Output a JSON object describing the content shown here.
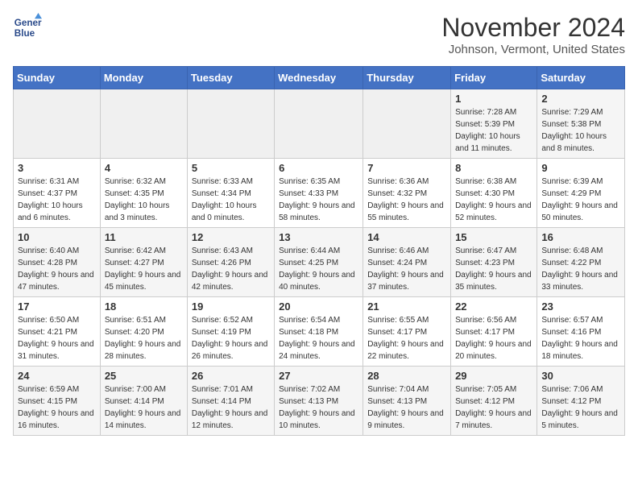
{
  "logo": {
    "line1": "General",
    "line2": "Blue"
  },
  "title": "November 2024",
  "location": "Johnson, Vermont, United States",
  "days_of_week": [
    "Sunday",
    "Monday",
    "Tuesday",
    "Wednesday",
    "Thursday",
    "Friday",
    "Saturday"
  ],
  "weeks": [
    [
      {
        "day": "",
        "sunrise": "",
        "sunset": "",
        "daylight": ""
      },
      {
        "day": "",
        "sunrise": "",
        "sunset": "",
        "daylight": ""
      },
      {
        "day": "",
        "sunrise": "",
        "sunset": "",
        "daylight": ""
      },
      {
        "day": "",
        "sunrise": "",
        "sunset": "",
        "daylight": ""
      },
      {
        "day": "",
        "sunrise": "",
        "sunset": "",
        "daylight": ""
      },
      {
        "day": "1",
        "sunrise": "Sunrise: 7:28 AM",
        "sunset": "Sunset: 5:39 PM",
        "daylight": "Daylight: 10 hours and 11 minutes."
      },
      {
        "day": "2",
        "sunrise": "Sunrise: 7:29 AM",
        "sunset": "Sunset: 5:38 PM",
        "daylight": "Daylight: 10 hours and 8 minutes."
      }
    ],
    [
      {
        "day": "3",
        "sunrise": "Sunrise: 6:31 AM",
        "sunset": "Sunset: 4:37 PM",
        "daylight": "Daylight: 10 hours and 6 minutes."
      },
      {
        "day": "4",
        "sunrise": "Sunrise: 6:32 AM",
        "sunset": "Sunset: 4:35 PM",
        "daylight": "Daylight: 10 hours and 3 minutes."
      },
      {
        "day": "5",
        "sunrise": "Sunrise: 6:33 AM",
        "sunset": "Sunset: 4:34 PM",
        "daylight": "Daylight: 10 hours and 0 minutes."
      },
      {
        "day": "6",
        "sunrise": "Sunrise: 6:35 AM",
        "sunset": "Sunset: 4:33 PM",
        "daylight": "Daylight: 9 hours and 58 minutes."
      },
      {
        "day": "7",
        "sunrise": "Sunrise: 6:36 AM",
        "sunset": "Sunset: 4:32 PM",
        "daylight": "Daylight: 9 hours and 55 minutes."
      },
      {
        "day": "8",
        "sunrise": "Sunrise: 6:38 AM",
        "sunset": "Sunset: 4:30 PM",
        "daylight": "Daylight: 9 hours and 52 minutes."
      },
      {
        "day": "9",
        "sunrise": "Sunrise: 6:39 AM",
        "sunset": "Sunset: 4:29 PM",
        "daylight": "Daylight: 9 hours and 50 minutes."
      }
    ],
    [
      {
        "day": "10",
        "sunrise": "Sunrise: 6:40 AM",
        "sunset": "Sunset: 4:28 PM",
        "daylight": "Daylight: 9 hours and 47 minutes."
      },
      {
        "day": "11",
        "sunrise": "Sunrise: 6:42 AM",
        "sunset": "Sunset: 4:27 PM",
        "daylight": "Daylight: 9 hours and 45 minutes."
      },
      {
        "day": "12",
        "sunrise": "Sunrise: 6:43 AM",
        "sunset": "Sunset: 4:26 PM",
        "daylight": "Daylight: 9 hours and 42 minutes."
      },
      {
        "day": "13",
        "sunrise": "Sunrise: 6:44 AM",
        "sunset": "Sunset: 4:25 PM",
        "daylight": "Daylight: 9 hours and 40 minutes."
      },
      {
        "day": "14",
        "sunrise": "Sunrise: 6:46 AM",
        "sunset": "Sunset: 4:24 PM",
        "daylight": "Daylight: 9 hours and 37 minutes."
      },
      {
        "day": "15",
        "sunrise": "Sunrise: 6:47 AM",
        "sunset": "Sunset: 4:23 PM",
        "daylight": "Daylight: 9 hours and 35 minutes."
      },
      {
        "day": "16",
        "sunrise": "Sunrise: 6:48 AM",
        "sunset": "Sunset: 4:22 PM",
        "daylight": "Daylight: 9 hours and 33 minutes."
      }
    ],
    [
      {
        "day": "17",
        "sunrise": "Sunrise: 6:50 AM",
        "sunset": "Sunset: 4:21 PM",
        "daylight": "Daylight: 9 hours and 31 minutes."
      },
      {
        "day": "18",
        "sunrise": "Sunrise: 6:51 AM",
        "sunset": "Sunset: 4:20 PM",
        "daylight": "Daylight: 9 hours and 28 minutes."
      },
      {
        "day": "19",
        "sunrise": "Sunrise: 6:52 AM",
        "sunset": "Sunset: 4:19 PM",
        "daylight": "Daylight: 9 hours and 26 minutes."
      },
      {
        "day": "20",
        "sunrise": "Sunrise: 6:54 AM",
        "sunset": "Sunset: 4:18 PM",
        "daylight": "Daylight: 9 hours and 24 minutes."
      },
      {
        "day": "21",
        "sunrise": "Sunrise: 6:55 AM",
        "sunset": "Sunset: 4:17 PM",
        "daylight": "Daylight: 9 hours and 22 minutes."
      },
      {
        "day": "22",
        "sunrise": "Sunrise: 6:56 AM",
        "sunset": "Sunset: 4:17 PM",
        "daylight": "Daylight: 9 hours and 20 minutes."
      },
      {
        "day": "23",
        "sunrise": "Sunrise: 6:57 AM",
        "sunset": "Sunset: 4:16 PM",
        "daylight": "Daylight: 9 hours and 18 minutes."
      }
    ],
    [
      {
        "day": "24",
        "sunrise": "Sunrise: 6:59 AM",
        "sunset": "Sunset: 4:15 PM",
        "daylight": "Daylight: 9 hours and 16 minutes."
      },
      {
        "day": "25",
        "sunrise": "Sunrise: 7:00 AM",
        "sunset": "Sunset: 4:14 PM",
        "daylight": "Daylight: 9 hours and 14 minutes."
      },
      {
        "day": "26",
        "sunrise": "Sunrise: 7:01 AM",
        "sunset": "Sunset: 4:14 PM",
        "daylight": "Daylight: 9 hours and 12 minutes."
      },
      {
        "day": "27",
        "sunrise": "Sunrise: 7:02 AM",
        "sunset": "Sunset: 4:13 PM",
        "daylight": "Daylight: 9 hours and 10 minutes."
      },
      {
        "day": "28",
        "sunrise": "Sunrise: 7:04 AM",
        "sunset": "Sunset: 4:13 PM",
        "daylight": "Daylight: 9 hours and 9 minutes."
      },
      {
        "day": "29",
        "sunrise": "Sunrise: 7:05 AM",
        "sunset": "Sunset: 4:12 PM",
        "daylight": "Daylight: 9 hours and 7 minutes."
      },
      {
        "day": "30",
        "sunrise": "Sunrise: 7:06 AM",
        "sunset": "Sunset: 4:12 PM",
        "daylight": "Daylight: 9 hours and 5 minutes."
      }
    ]
  ]
}
